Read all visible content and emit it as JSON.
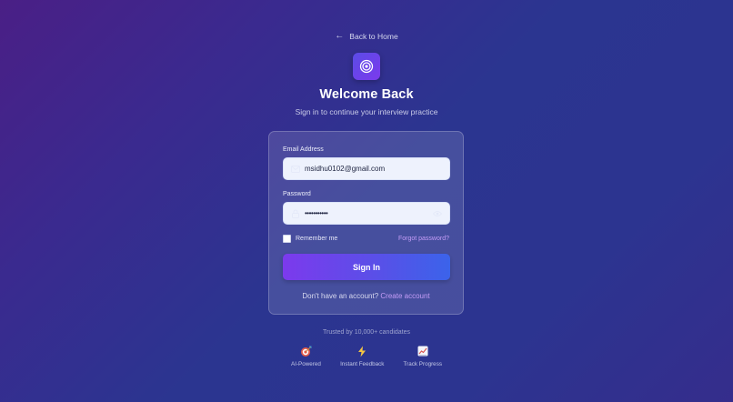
{
  "nav": {
    "back_label": "Back to Home"
  },
  "header": {
    "title": "Welcome Back",
    "subtitle": "Sign in to continue your interview practice"
  },
  "form": {
    "email_label": "Email Address",
    "email_value": "msidhu0102@gmail.com",
    "password_label": "Password",
    "password_value": "•••••••••••",
    "remember_label": "Remember me",
    "forgot_label": "Forgot password?",
    "signin_label": "Sign In",
    "no_account_text": "Don't have an account?",
    "create_account_label": "Create account"
  },
  "footer": {
    "trusted_text": "Trusted by 10,000+ candidates",
    "features": [
      {
        "icon": "target-dart-icon",
        "label": "AI-Powered"
      },
      {
        "icon": "lightning-icon",
        "label": "Instant Feedback"
      },
      {
        "icon": "chart-icon",
        "label": "Track Progress"
      }
    ]
  },
  "colors": {
    "accent_purple": "#7c3aed",
    "accent_blue": "#3b63ea",
    "link": "#c49cf7"
  }
}
